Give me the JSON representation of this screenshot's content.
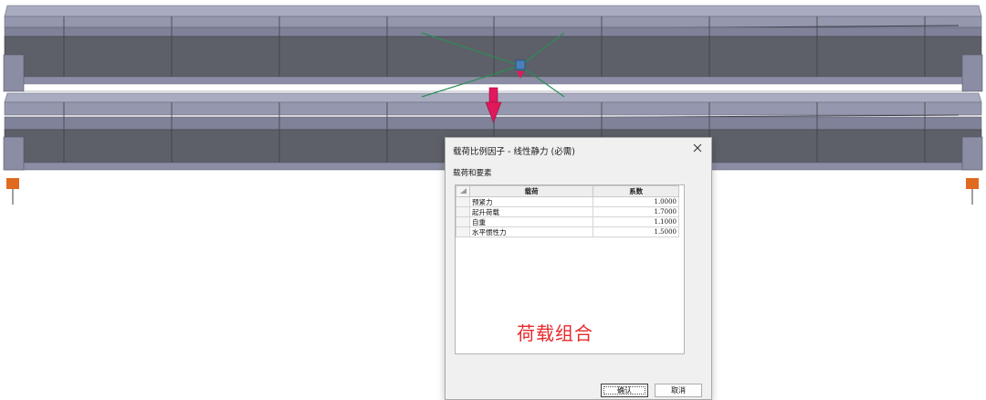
{
  "dialog": {
    "title": "载荷比例因子 - 线性静力 (必需)",
    "group_label": "载荷和要素",
    "table": {
      "headers": [
        "载荷",
        "系数"
      ],
      "rows": [
        {
          "load": "预紧力",
          "factor": "1.0000"
        },
        {
          "load": "起升荷载",
          "factor": "1.7000"
        },
        {
          "load": "自重",
          "factor": "1.1000"
        },
        {
          "load": "水平惯性力",
          "factor": "1.5000"
        }
      ]
    },
    "annotation": "荷载组合",
    "ok_label": "确认",
    "cancel_label": "取消",
    "close_icon": "close-icon"
  },
  "model": {
    "beam_color": "#8c90a8",
    "web_color": "#5d6068",
    "load_arrow_color": "#e0185c",
    "cross_bracing_color": "#2e8b57",
    "support_color": "#e06a20"
  }
}
